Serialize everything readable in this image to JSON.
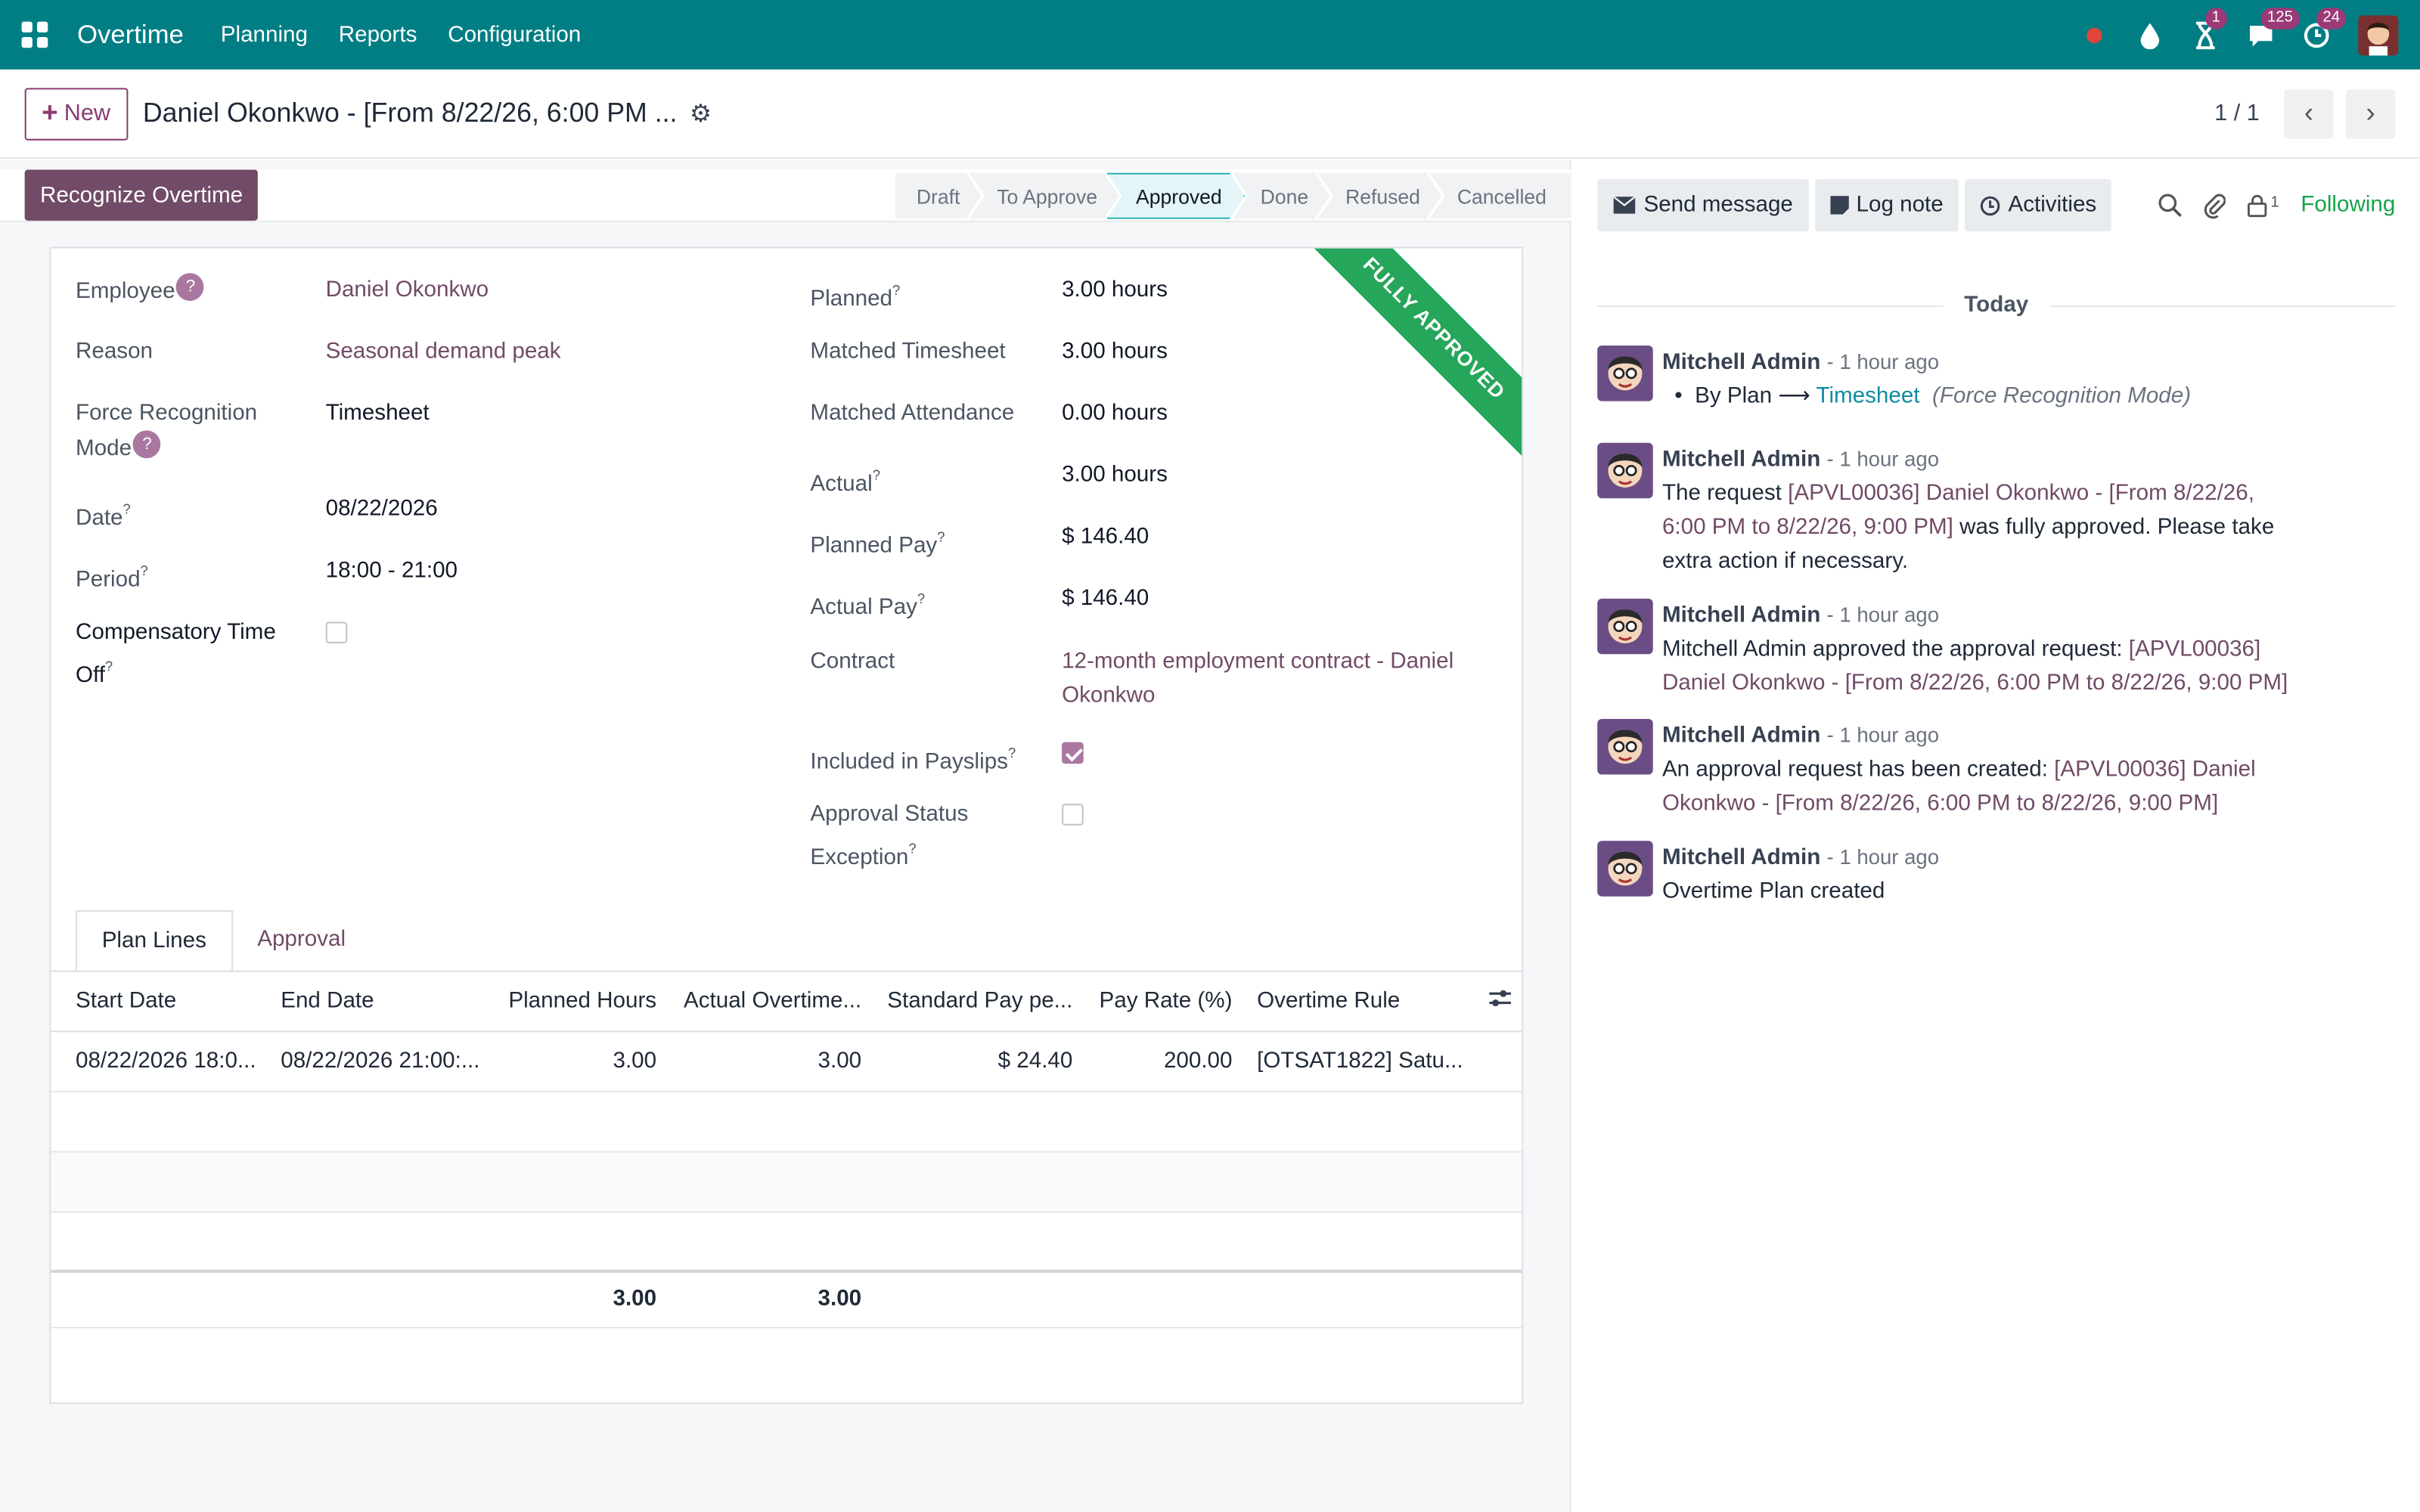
{
  "nav": {
    "brand": "Overtime",
    "menus": [
      "Planning",
      "Reports",
      "Configuration"
    ],
    "activity_badge": "1",
    "messages_badge": "125",
    "clock_badge": "24"
  },
  "controlbar": {
    "new_label": "New",
    "record_title": "Daniel Okonkwo - [From 8/22/26, 6:00 PM ...",
    "pager": "1 / 1"
  },
  "statusbar": {
    "action_label": "Recognize Overtime",
    "stages": [
      "Draft",
      "To Approve",
      "Approved",
      "Done",
      "Refused",
      "Cancelled"
    ],
    "active_stage": "Approved"
  },
  "ribbon": "FULLY APPROVED",
  "form": {
    "employee_label": "Employee",
    "employee_value": "Daniel Okonkwo",
    "reason_label": "Reason",
    "reason_value": "Seasonal demand peak",
    "force_label_1": "Force Recognition",
    "force_label_2": "Mode",
    "force_value": "Timesheet",
    "date_label": "Date",
    "date_value": "08/22/2026",
    "period_label": "Period",
    "period_value": "18:00 - 21:00",
    "comp_label_1": "Compensatory Time",
    "comp_label_2": "Off",
    "planned_label": "Planned",
    "planned_value": "3.00 hours",
    "matched_ts_label": "Matched Timesheet",
    "matched_ts_value": "3.00 hours",
    "matched_att_label": "Matched Attendance",
    "matched_att_value": "0.00 hours",
    "actual_label": "Actual",
    "actual_value": "3.00 hours",
    "planned_pay_label": "Planned Pay",
    "planned_pay_value": "$ 146.40",
    "actual_pay_label": "Actual Pay",
    "actual_pay_value": "$ 146.40",
    "contract_label": "Contract",
    "contract_value_1": "12-month employment contract - Daniel",
    "contract_value_2": "Okonkwo",
    "payslips_label": "Included in Payslips",
    "exception_label_1": "Approval Status",
    "exception_label_2": "Exception"
  },
  "tabs": [
    "Plan Lines",
    "Approval"
  ],
  "table": {
    "headers": [
      "Start Date",
      "End Date",
      "Planned Hours",
      "Actual Overtime...",
      "Standard Pay pe...",
      "Pay Rate (%)",
      "Overtime Rule"
    ],
    "row": [
      "08/22/2026 18:0...",
      "08/22/2026 21:00:...",
      "3.00",
      "3.00",
      "$ 24.40",
      "200.00",
      "[OTSAT1822] Satu..."
    ],
    "total_planned": "3.00",
    "total_actual": "3.00"
  },
  "chatter": {
    "send_message": "Send message",
    "log_note": "Log note",
    "activities": "Activities",
    "followers_count": "1",
    "following": "Following",
    "today": "Today",
    "author": "Mitchell Admin",
    "time": "- 1 hour ago",
    "m1_from": "By Plan",
    "m1_to": "Timesheet",
    "m1_field": "(Force Recognition Mode)",
    "m2_a": "The request ",
    "m2_link_1": "[APVL00036] Daniel Okonkwo - [From 8/22/26,",
    "m2_link_2": "6:00 PM to 8/22/26, 9:00 PM]",
    "m2_b": " was fully approved. Please take",
    "m2_c": "extra action if necessary.",
    "m3_a": "Mitchell Admin approved the approval request: ",
    "m3_link_1": "[APVL00036]",
    "m3_link_2": "Daniel Okonkwo - [From 8/22/26, 6:00 PM to 8/22/26, 9:00 PM]",
    "m4_a": "An approval request has been created: ",
    "m4_link_1": "[APVL00036] Daniel",
    "m4_link_2": "Okonkwo - [From 8/22/26, 6:00 PM to 8/22/26, 9:00 PM]",
    "m5": "Overtime Plan created"
  },
  "colors": {
    "nav": "#017e84",
    "primary": "#714b67",
    "ribbon": "#26a65b",
    "following": "#16a34a"
  }
}
